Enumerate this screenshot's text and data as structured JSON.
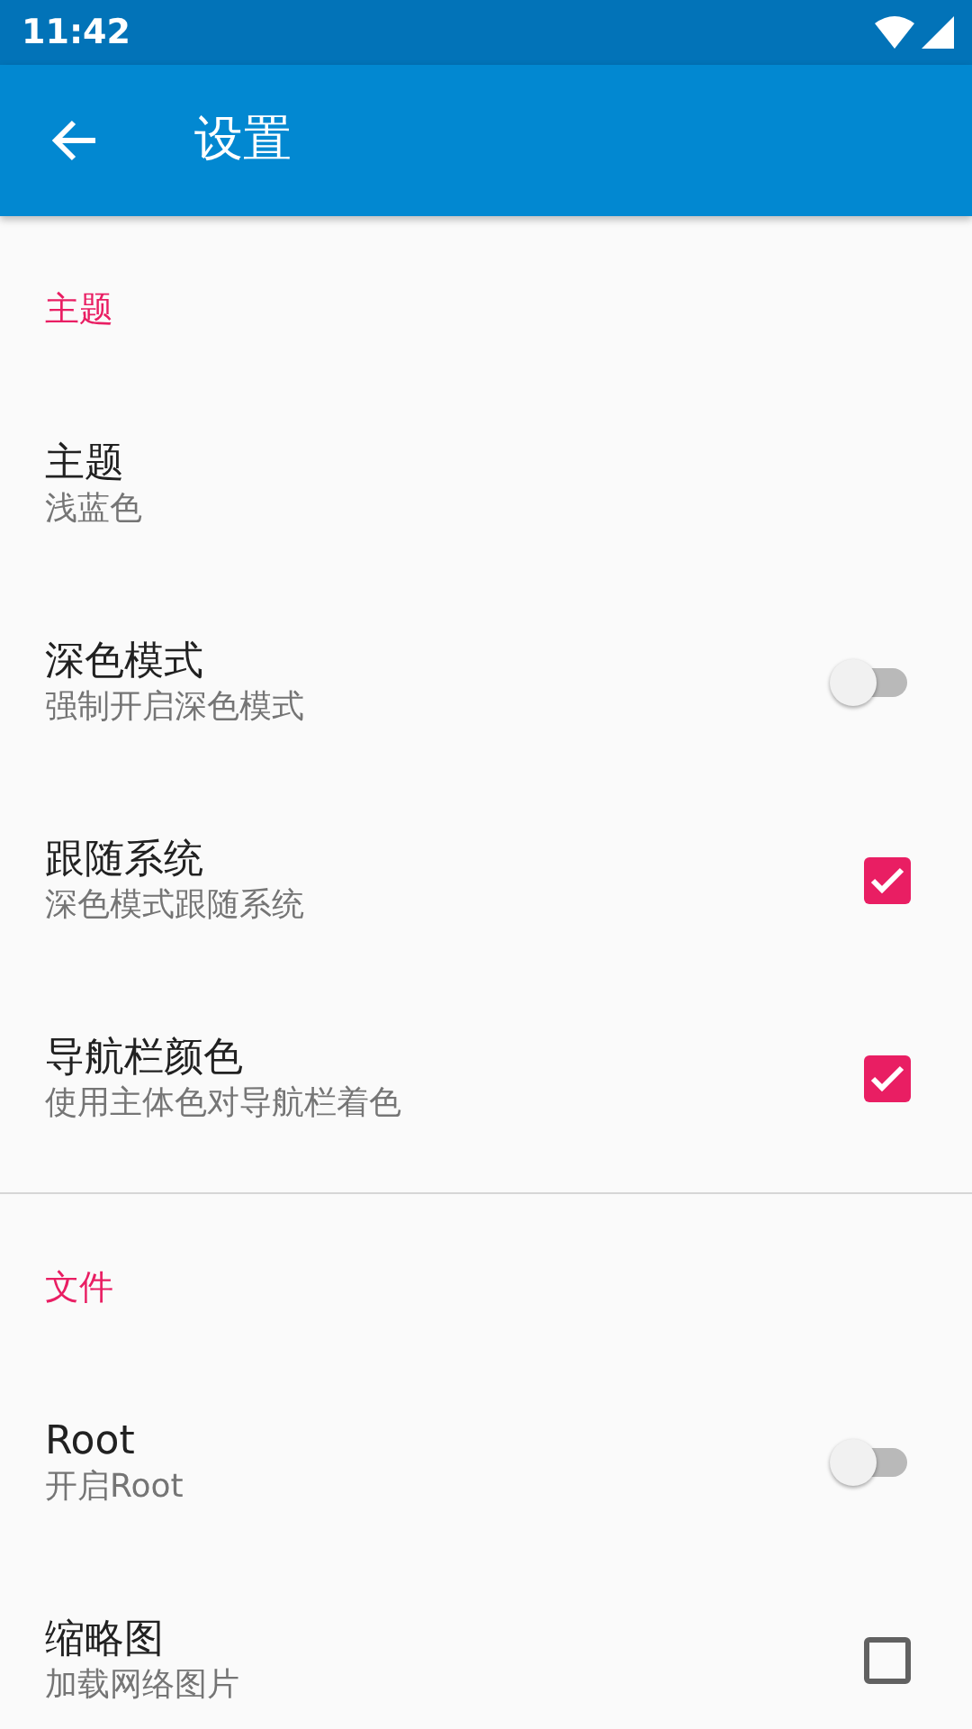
{
  "status_bar": {
    "time": "11:42"
  },
  "app_bar": {
    "title": "设置"
  },
  "sections": [
    {
      "title": "主题",
      "items": [
        {
          "kind": "text",
          "title": "主题",
          "summary": "浅蓝色"
        },
        {
          "kind": "switch",
          "title": "深色模式",
          "summary": "强制开启深色模式",
          "on": false
        },
        {
          "kind": "checkbox",
          "title": "跟随系统",
          "summary": "深色模式跟随系统",
          "checked": true
        },
        {
          "kind": "checkbox",
          "title": "导航栏颜色",
          "summary": "使用主体色对导航栏着色",
          "checked": true
        }
      ]
    },
    {
      "title": "文件",
      "items": [
        {
          "kind": "switch",
          "title": "Root",
          "summary": "开启Root",
          "on": false
        },
        {
          "kind": "checkbox",
          "title": "缩略图",
          "summary": "加载网络图片",
          "checked": false
        }
      ]
    }
  ]
}
